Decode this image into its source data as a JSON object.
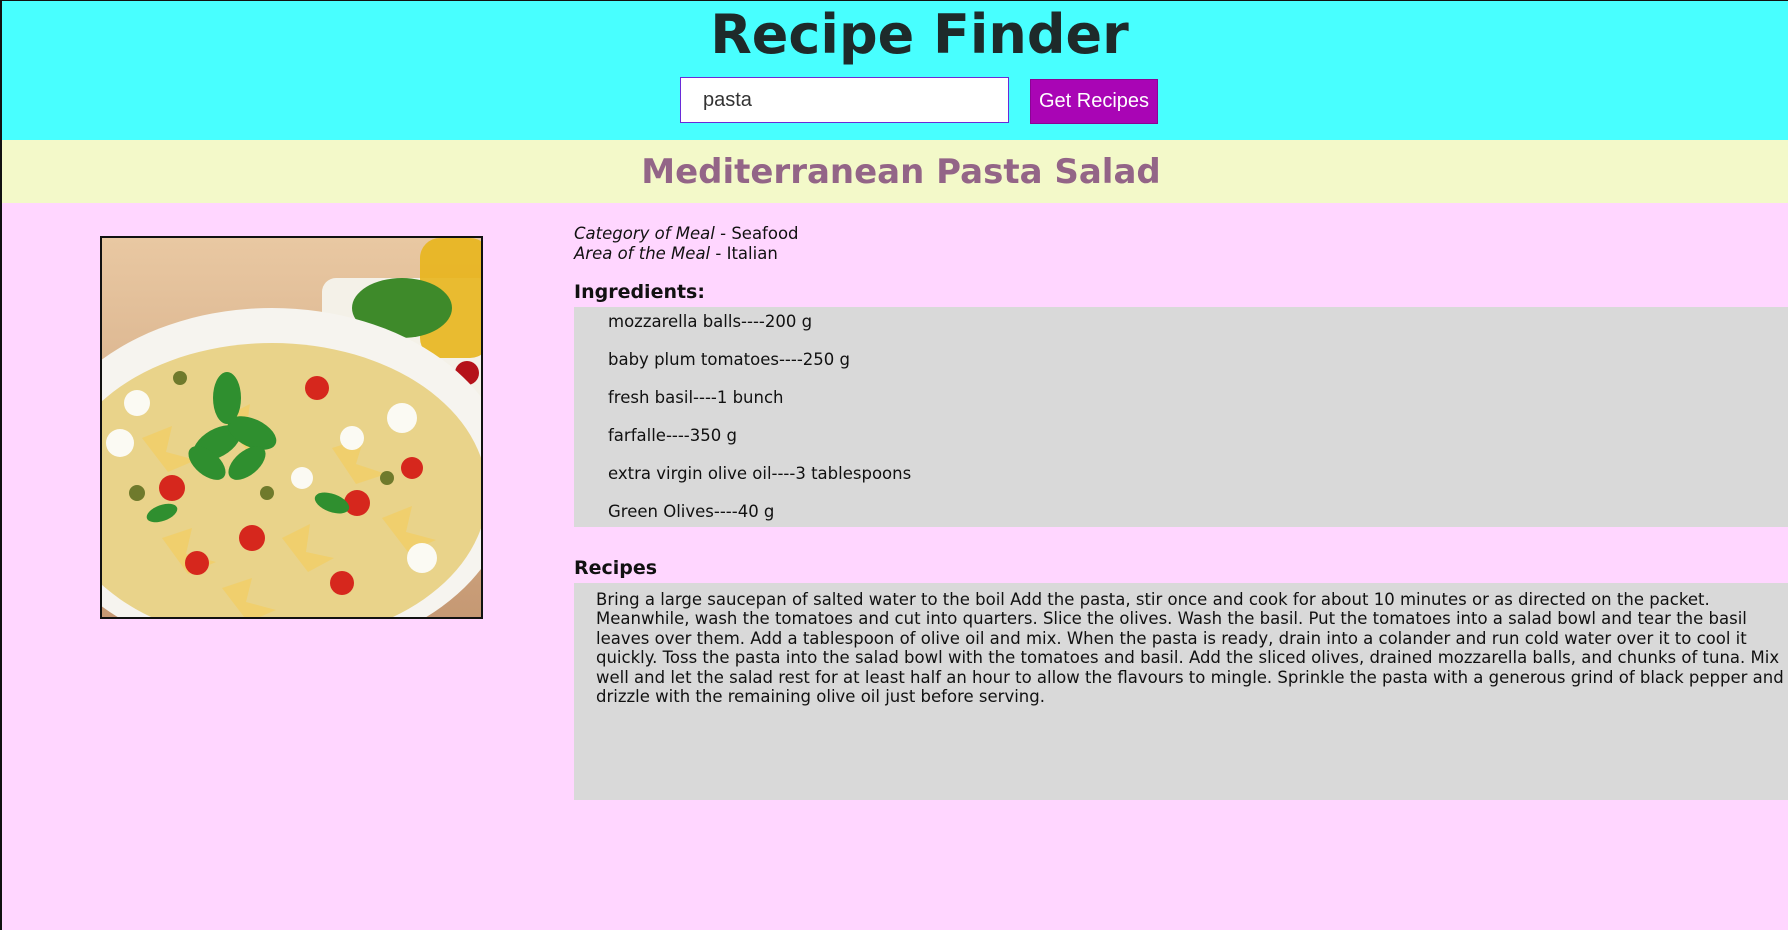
{
  "header": {
    "title": "Recipe Finder",
    "search_value": "pasta",
    "button_label": "Get Recipes"
  },
  "meal": {
    "name": "Mediterranean Pasta Salad",
    "category_label": "Category of Meal",
    "category_value": "Seafood",
    "area_label": "Area of the Meal",
    "area_value": "Italian",
    "separator": " - "
  },
  "ingredients": {
    "heading": "Ingredients:",
    "items": [
      "mozzarella balls----200 g",
      "baby plum tomatoes----250 g",
      "fresh basil----1 bunch",
      "farfalle----350 g",
      "extra virgin olive oil----3 tablespoons",
      "Green Olives----40 g"
    ]
  },
  "recipes": {
    "heading": "Recipes",
    "text": "Bring a large saucepan of salted water to the boil Add the pasta, stir once and cook for about 10 minutes or as directed on the packet. Meanwhile, wash the tomatoes and cut into quarters. Slice the olives. Wash the basil. Put the tomatoes into a salad bowl and tear the basil leaves over them. Add a tablespoon of olive oil and mix. When the pasta is ready, drain into a colander and run cold water over it to cool it quickly. Toss the pasta into the salad bowl with the tomatoes and basil. Add the sliced olives, drained mozzarella balls, and chunks of tuna. Mix well and let the salad rest for at least half an hour to allow the flavours to mingle. Sprinkle the pasta with a generous grind of black pepper and drizzle with the remaining olive oil just before serving."
  },
  "colors": {
    "header_bg": "#48ffff",
    "banner_bg": "#f3f9c9",
    "page_bg": "#ffd6ff",
    "button_bg": "#a905b5",
    "meal_title": "#936587",
    "box_bg": "#d9d9d9"
  }
}
